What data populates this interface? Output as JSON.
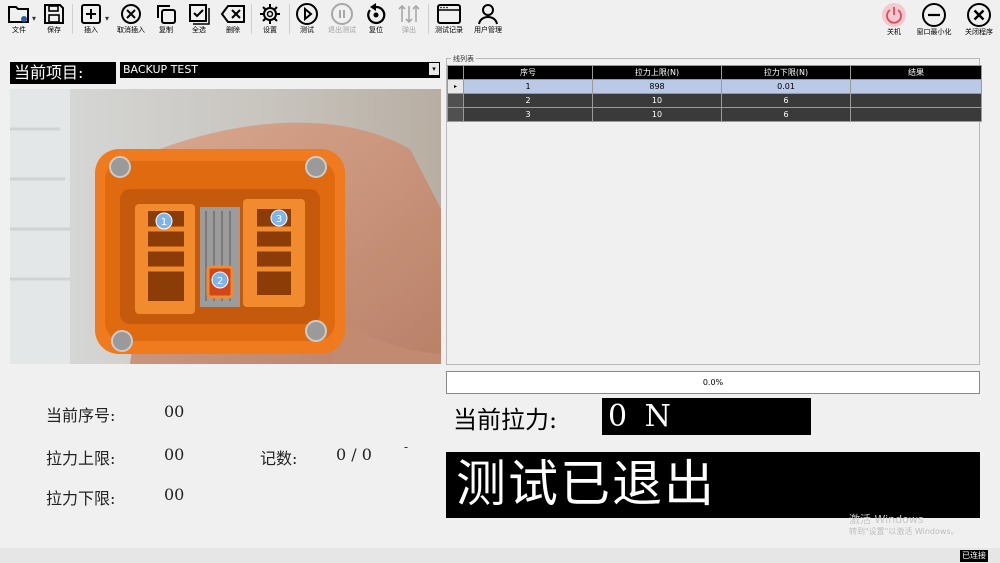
{
  "toolbar": {
    "left": [
      {
        "label": "文件",
        "icon": "folder-icon"
      },
      {
        "label": "保存",
        "icon": "save-icon"
      },
      {
        "label": "插入",
        "icon": "plus-square-icon"
      },
      {
        "label": "取消插入",
        "icon": "cancel-insert-icon"
      },
      {
        "label": "复制",
        "icon": "copy-icon"
      },
      {
        "label": "全选",
        "icon": "select-all-icon"
      },
      {
        "label": "删除",
        "icon": "delete-icon"
      },
      {
        "label": "设置",
        "icon": "settings-icon"
      },
      {
        "label": "测试",
        "icon": "play-icon"
      },
      {
        "label": "退出测试",
        "icon": "pause-icon"
      },
      {
        "label": "复位",
        "icon": "reset-icon"
      },
      {
        "label": "弹出",
        "icon": "eject-icon"
      },
      {
        "label": "测试记录",
        "icon": "test-record-icon"
      },
      {
        "label": "用户管理",
        "icon": "user-icon"
      }
    ],
    "right": [
      {
        "label": "关机",
        "icon": "power-icon"
      },
      {
        "label": "窗口最小化",
        "icon": "minimize-icon"
      },
      {
        "label": "关闭程序",
        "icon": "close-icon"
      }
    ]
  },
  "project": {
    "label": "当前项目:",
    "value": "BACKUP TEST"
  },
  "photo": {
    "markers": [
      "1",
      "2",
      "3"
    ]
  },
  "list": {
    "title": "线列表",
    "columns": [
      "序号",
      "拉力上限(N)",
      "拉力下限(N)",
      "结果"
    ],
    "rows": [
      {
        "seq": "1",
        "upper": "898",
        "lower": "0.01",
        "result": "",
        "selected": true
      },
      {
        "seq": "2",
        "upper": "10",
        "lower": "6",
        "result": "",
        "selected": false
      },
      {
        "seq": "3",
        "upper": "10",
        "lower": "6",
        "result": "",
        "selected": false
      }
    ],
    "row_indicator": "▸"
  },
  "progress": {
    "text": "0.0%",
    "value": 0
  },
  "stats": {
    "seq_label": "当前序号:",
    "seq_value": "00",
    "upper_label": "拉力上限:",
    "upper_value": "00",
    "lower_label": "拉力下限:",
    "lower_value": "00",
    "count_label": "记数:",
    "count_value": "0 / 0",
    "count_extra": "-"
  },
  "force": {
    "label": "当前拉力:",
    "value": "0 N"
  },
  "status_message": "测试已退出",
  "watermark": {
    "line1": "激活 Windows",
    "line2": "转到\"设置\"以激活 Windows。"
  },
  "statusbar": {
    "connection": "已连接"
  },
  "colors": {
    "accent_orange": "#f07a1e",
    "marker_blue": "#7fb4ea",
    "selected_row": "#b9c9e6",
    "progress_green": "#06b025"
  }
}
